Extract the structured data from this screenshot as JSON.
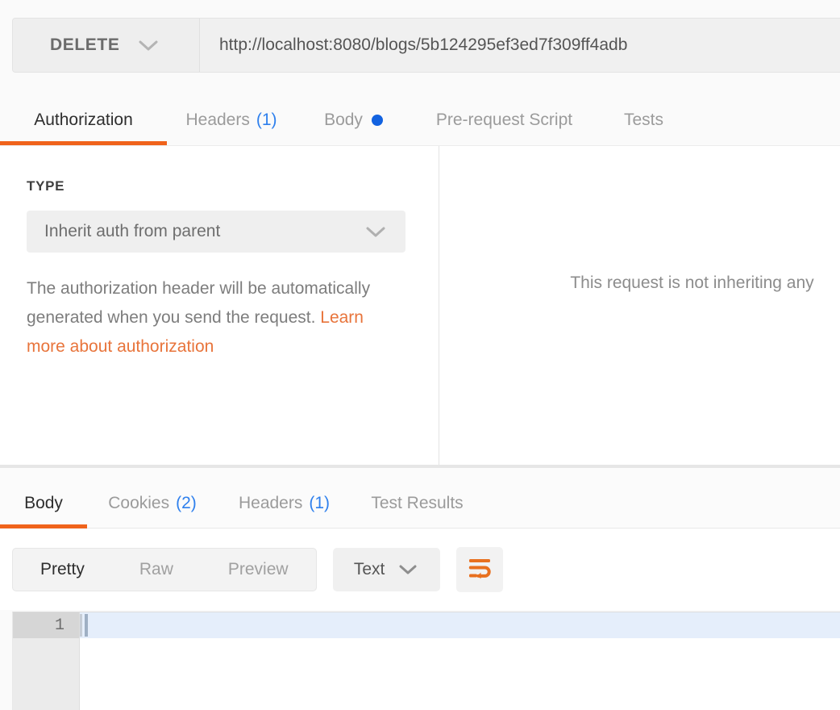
{
  "request": {
    "method": "DELETE",
    "method_caret_icon": "chevron-down-icon",
    "url": "http://localhost:8080/blogs/5b124295ef3ed7f309ff4adb",
    "url_placeholder": "Enter request URL",
    "tabs": [
      {
        "label": "Authorization",
        "count": "",
        "active": true,
        "dot": false
      },
      {
        "label": "Headers",
        "count": "(1)",
        "active": false,
        "dot": false
      },
      {
        "label": "Body",
        "count": "",
        "active": false,
        "dot": true
      },
      {
        "label": "Pre-request Script",
        "count": "",
        "active": false,
        "dot": false
      },
      {
        "label": "Tests",
        "count": "",
        "active": false,
        "dot": false
      }
    ]
  },
  "authorization": {
    "type_label": "TYPE",
    "type_value": "Inherit auth from parent",
    "type_caret_icon": "chevron-down-icon",
    "description_part1": "The authorization header will be automatically generated when you send the request. ",
    "link_text": "Learn more about authorization",
    "right_panel_text": "This request is not inheriting any"
  },
  "response": {
    "tabs": [
      {
        "label": "Body",
        "count": "",
        "active": true
      },
      {
        "label": "Cookies",
        "count": "(2)",
        "active": false
      },
      {
        "label": "Headers",
        "count": "(1)",
        "active": false
      },
      {
        "label": "Test Results",
        "count": "",
        "active": false
      }
    ],
    "view_modes": [
      {
        "label": "Pretty",
        "active": true
      },
      {
        "label": "Raw",
        "active": false
      },
      {
        "label": "Preview",
        "active": false
      }
    ],
    "format_value": "Text",
    "format_caret_icon": "chevron-down-icon",
    "wrap_icon": "word-wrap-icon",
    "editor": {
      "line_numbers": [
        "1"
      ],
      "lines": [
        ""
      ]
    }
  },
  "colors": {
    "accent_orange": "#f0631b",
    "link_orange": "#e8743b",
    "tab_count_blue": "#2f80ed",
    "dot_blue": "#1262e0",
    "active_line_blue": "#e5eefb"
  }
}
